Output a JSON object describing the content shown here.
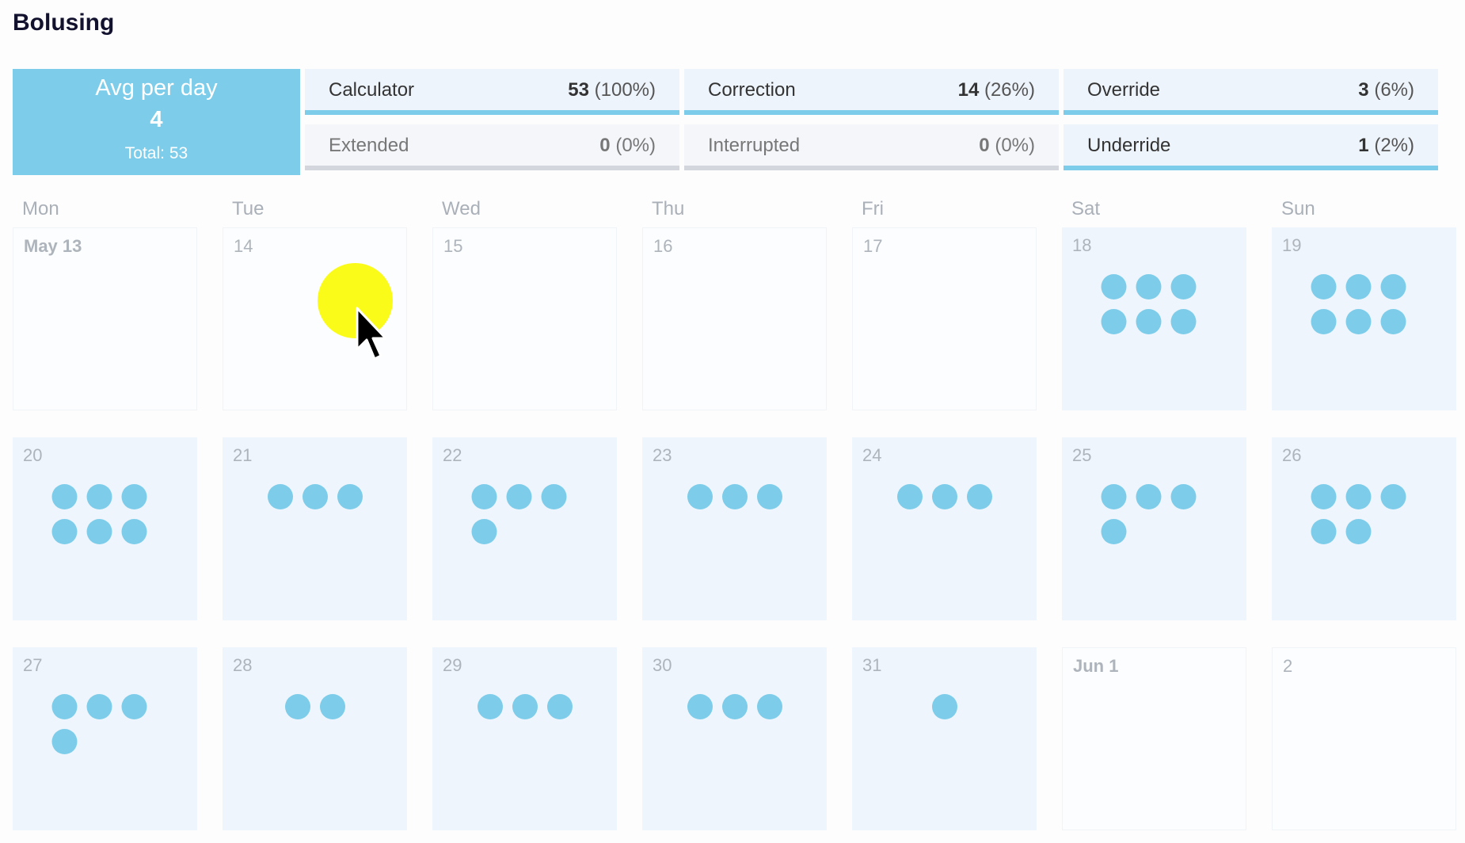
{
  "title": "Bolusing",
  "summary": {
    "avg_label": "Avg per day",
    "avg_value": "4",
    "total_label": "Total:",
    "total_value": "53",
    "stats": {
      "calculator": {
        "label": "Calculator",
        "count": "53",
        "pct": "(100%)"
      },
      "correction": {
        "label": "Correction",
        "count": "14",
        "pct": "(26%)"
      },
      "override": {
        "label": "Override",
        "count": "3",
        "pct": "(6%)"
      },
      "extended": {
        "label": "Extended",
        "count": "0",
        "pct": "(0%)"
      },
      "interrupted": {
        "label": "Interrupted",
        "count": "0",
        "pct": "(0%)"
      },
      "underride": {
        "label": "Underride",
        "count": "1",
        "pct": "(2%)"
      }
    }
  },
  "weekdays": [
    "Mon",
    "Tue",
    "Wed",
    "Thu",
    "Fri",
    "Sat",
    "Sun"
  ],
  "calendar": [
    [
      {
        "date": "May 13",
        "bolus_count": 0
      },
      {
        "date": "14",
        "bolus_count": 0
      },
      {
        "date": "15",
        "bolus_count": 0
      },
      {
        "date": "16",
        "bolus_count": 0
      },
      {
        "date": "17",
        "bolus_count": 0
      },
      {
        "date": "18",
        "bolus_count": 6
      },
      {
        "date": "19",
        "bolus_count": 6
      }
    ],
    [
      {
        "date": "20",
        "bolus_count": 6
      },
      {
        "date": "21",
        "bolus_count": 3
      },
      {
        "date": "22",
        "bolus_count": 4
      },
      {
        "date": "23",
        "bolus_count": 3
      },
      {
        "date": "24",
        "bolus_count": 3
      },
      {
        "date": "25",
        "bolus_count": 4
      },
      {
        "date": "26",
        "bolus_count": 5
      }
    ],
    [
      {
        "date": "27",
        "bolus_count": 4
      },
      {
        "date": "28",
        "bolus_count": 2
      },
      {
        "date": "29",
        "bolus_count": 3
      },
      {
        "date": "30",
        "bolus_count": 3
      },
      {
        "date": "31",
        "bolus_count": 1
      },
      {
        "date": "Jun 1",
        "bolus_count": 0
      },
      {
        "date": "2",
        "bolus_count": 0
      }
    ]
  ],
  "colors": {
    "accent": "#7dcdea",
    "cell_bg": "#eff5fc",
    "cursor_highlight": "#fbfb1a"
  }
}
